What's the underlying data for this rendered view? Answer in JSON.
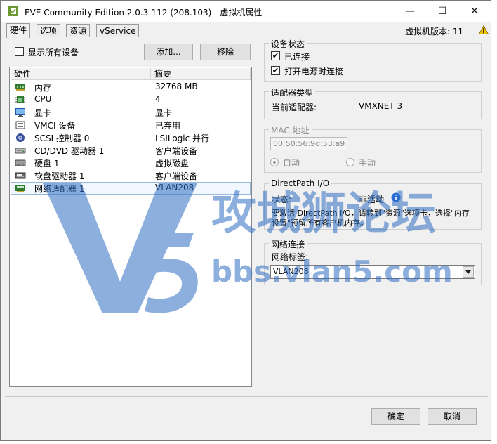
{
  "window": {
    "title": "EVE Community Edition 2.0.3-112 (208.103) - 虚拟机属性",
    "controls": {
      "minimize": "—",
      "maximize": "☐",
      "close": "✕"
    }
  },
  "tabs": [
    {
      "label": "硬件",
      "active": true
    },
    {
      "label": "选项",
      "active": false
    },
    {
      "label": "资源",
      "active": false
    },
    {
      "label": "vService",
      "active": false
    }
  ],
  "vm_version": "虚拟机版本: 11",
  "show_all_devices": {
    "label": "显示所有设备",
    "checked": false
  },
  "buttons": {
    "add": "添加...",
    "remove": "移除",
    "ok": "确定",
    "cancel": "取消"
  },
  "hardware_list": {
    "columns": [
      "硬件",
      "摘要"
    ],
    "rows": [
      {
        "icon": "memory-icon",
        "name": "内存",
        "summary": "32768 MB"
      },
      {
        "icon": "cpu-icon",
        "name": "CPU",
        "summary": "4"
      },
      {
        "icon": "monitor-icon",
        "name": "显卡",
        "summary": "显卡"
      },
      {
        "icon": "vmci-icon",
        "name": "VMCI 设备",
        "summary": "已弃用"
      },
      {
        "icon": "scsi-icon",
        "name": "SCSI 控制器 0",
        "summary": "LSILogic 并行"
      },
      {
        "icon": "cdrom-icon",
        "name": "CD/DVD 驱动器 1",
        "summary": "客户端设备"
      },
      {
        "icon": "harddisk-icon",
        "name": "硬盘 1",
        "summary": "虚拟磁盘"
      },
      {
        "icon": "floppy-icon",
        "name": "软盘驱动器 1",
        "summary": "客户端设备"
      },
      {
        "icon": "network-icon",
        "name": "网络适配器 1",
        "summary": "VLAN208",
        "selected": true
      }
    ]
  },
  "device_status": {
    "title": "设备状态",
    "connected": {
      "label": "已连接",
      "checked": true
    },
    "connect_at_power_on": {
      "label": "打开电源时连接",
      "checked": true
    }
  },
  "adapter_type": {
    "title": "适配器类型",
    "current_label": "当前适配器:",
    "current_value": "VMXNET 3"
  },
  "mac_address": {
    "title": "MAC 地址",
    "value": "00:50:56:9d:53:a9",
    "auto": "自动",
    "manual": "手动"
  },
  "directpath": {
    "title": "DirectPath I/O",
    "status_label": "状态:",
    "status_value": "非活动",
    "note": "要激活 DirectPath I/O，请转到\"资源\"选项卡，选择\"内存设置\"预留所有客户机内存。"
  },
  "network_connection": {
    "title": "网络连接",
    "label": "网络标签:",
    "selected": "VLAN208"
  },
  "watermark": {
    "logo": "V5",
    "cn": "攻城狮论坛",
    "url": "bbs.vlan5.com"
  },
  "colors": {
    "watermark_blue": "#2f6fc4",
    "warning_yellow": "#f2c200"
  }
}
